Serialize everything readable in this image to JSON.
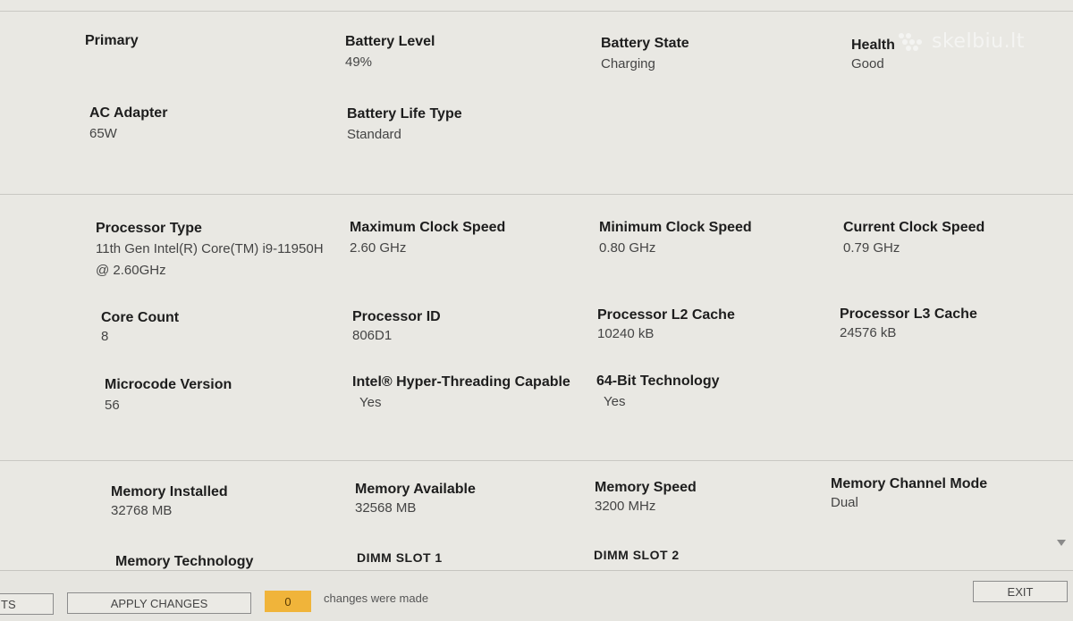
{
  "watermark": {
    "text": "skelbiu.lt"
  },
  "battery": {
    "primary_label": "Primary",
    "battery_level": {
      "label": "Battery Level",
      "value": "49%"
    },
    "battery_state": {
      "label": "Battery State",
      "value": "Charging"
    },
    "health": {
      "label": "Health",
      "value": "Good"
    },
    "ac_adapter": {
      "label": "AC Adapter",
      "value": "65W"
    },
    "battery_life_type": {
      "label": "Battery Life Type",
      "value": "Standard"
    }
  },
  "processor": {
    "processor_type": {
      "label": "Processor Type",
      "value_line1": "11th Gen Intel(R) Core(TM) i9-11950H",
      "value_line2": "@ 2.60GHz"
    },
    "max_clock": {
      "label": "Maximum Clock Speed",
      "value": "2.60 GHz"
    },
    "min_clock": {
      "label": "Minimum Clock Speed",
      "value": "0.80 GHz"
    },
    "current_clock": {
      "label": "Current Clock Speed",
      "value": "0.79 GHz"
    },
    "core_count": {
      "label": "Core Count",
      "value": "8"
    },
    "processor_id": {
      "label": "Processor ID",
      "value": "806D1"
    },
    "l2_cache": {
      "label": "Processor L2 Cache",
      "value": "10240 kB"
    },
    "l3_cache": {
      "label": "Processor L3 Cache",
      "value": "24576 kB"
    },
    "microcode": {
      "label": "Microcode Version",
      "value": "56"
    },
    "hyper_threading": {
      "label": "Intel® Hyper-Threading Capable",
      "value": "Yes"
    },
    "bit64": {
      "label": "64-Bit Technology",
      "value": "Yes"
    }
  },
  "memory": {
    "installed": {
      "label": "Memory Installed",
      "value": "32768 MB"
    },
    "available": {
      "label": "Memory Available",
      "value": "32568 MB"
    },
    "speed": {
      "label": "Memory Speed",
      "value": "3200 MHz"
    },
    "channel_mode": {
      "label": "Memory Channel Mode",
      "value": "Dual"
    },
    "technology": {
      "label": "Memory Technology"
    },
    "dimm1": {
      "label": "DIMM SLOT 1"
    },
    "dimm2": {
      "label": "DIMM SLOT 2"
    }
  },
  "footer": {
    "left_button_partial": "TS",
    "apply_changes": "APPLY CHANGES",
    "change_count": "0",
    "changes_text": "changes were made",
    "exit": "EXIT"
  },
  "colors": {
    "counter_badge": "#f0b43a",
    "background": "#e9e8e3"
  },
  "icons": {
    "watermark_logo": "dots-logo-icon",
    "scroll": "scroll-down-arrow-icon"
  }
}
